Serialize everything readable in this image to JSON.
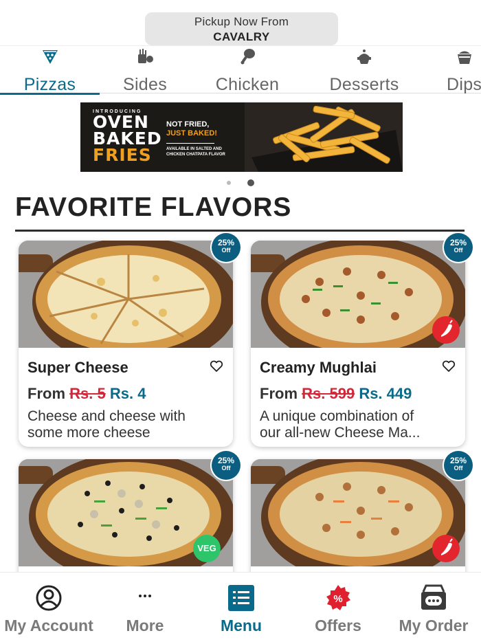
{
  "pickup": {
    "line1": "Pickup Now From",
    "line2": "CAVALRY"
  },
  "categories": [
    {
      "label": "Pizzas",
      "icon": "pizza-slice-icon",
      "active": true
    },
    {
      "label": "Sides",
      "icon": "sides-icon",
      "active": false
    },
    {
      "label": "Chicken",
      "icon": "drumstick-icon",
      "active": false
    },
    {
      "label": "Desserts",
      "icon": "dessert-icon",
      "active": false
    },
    {
      "label": "Dips",
      "icon": "dip-bowl-icon",
      "active": false
    }
  ],
  "banner": {
    "intro": "INTRODUCING",
    "line1": "OVEN",
    "line2": "BAKED",
    "line3": "FRIES",
    "tag1": "NOT FRIED,",
    "tag2": "JUST BAKED!",
    "avail1": "AVAILABLE IN SALTED AND",
    "avail2": "CHICKEN CHATPATA FLAVOR"
  },
  "carousel": {
    "total": 2,
    "active_index": 1
  },
  "section": {
    "title": "FAVORITE FLAVORS"
  },
  "products": [
    {
      "name": "Super Cheese",
      "price_prefix": "From",
      "old_price": "Rs. 5",
      "new_price": "Rs. 4",
      "desc_line1": "Cheese and cheese with",
      "desc_line2": "some more cheese",
      "badge_pct": "25%",
      "badge_off": "Off",
      "tag": ""
    },
    {
      "name": "Creamy Mughlai",
      "price_prefix": "From",
      "old_price": "Rs. 599",
      "new_price": "Rs. 449",
      "desc_line1": "A unique combination of",
      "desc_line2": "our all-new Cheese Ma...",
      "badge_pct": "25%",
      "badge_off": "Off",
      "tag": "spicy"
    },
    {
      "name": "",
      "badge_pct": "25%",
      "badge_off": "Off",
      "tag": "VEG"
    },
    {
      "name": "",
      "badge_pct": "25%",
      "badge_off": "Off",
      "tag": "spicy"
    }
  ],
  "bottom_nav": [
    {
      "label": "My Account",
      "icon": "account-icon"
    },
    {
      "label": "More",
      "icon": "more-dots-icon"
    },
    {
      "label": "Menu",
      "icon": "menu-list-icon",
      "active": true
    },
    {
      "label": "Offers",
      "icon": "offers-badge-icon"
    },
    {
      "label": "My Order",
      "icon": "order-tracker-icon"
    }
  ],
  "colors": {
    "accent": "#0a6a8c",
    "price_old": "#d4283a",
    "badge": "#0b5e7f",
    "spicy": "#e3262e",
    "veg": "#2ec46a",
    "offers": "#e0202e"
  }
}
